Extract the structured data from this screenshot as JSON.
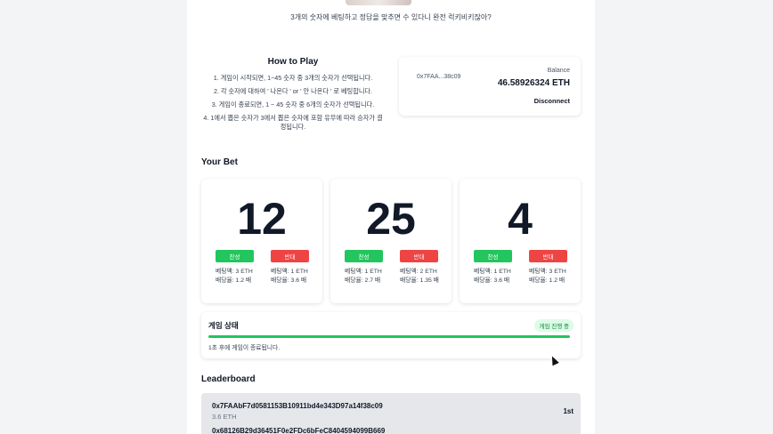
{
  "tagline": "3개의 숫자에 베팅하고 정답을 맞추면 수 있다니 완전 럭키비키잖아?",
  "how_to_play": {
    "title": "How to Play",
    "steps": [
      "1. 게임이 시작되면, 1~45 숫자 중 3개의 숫자가 선택됩니다.",
      "2. 각 숫자에 대하여 ' 나온다 ' or ' 안 나온다 ' 로 베팅합니다.",
      "3. 게임이 종료되면, 1 ~ 45 숫자 중 6개의 숫자가 선택됩니다.",
      "4. 1에서 뽑은 숫자가 3에서 뽑은 숫자에 포함 유무에 따라 승자가 결정됩니다."
    ]
  },
  "wallet": {
    "address": "0x7FAA...38c09",
    "balance_label": "Balance",
    "balance": "46.58926324 ETH",
    "disconnect_label": "Disconnect"
  },
  "your_bet_title": "Your Bet",
  "bets": [
    {
      "number": "12",
      "yes_label": "찬성",
      "no_label": "반대",
      "yes_amount": "베팅액: 3 ETH",
      "yes_odds": "배당율: 1.2 배",
      "no_amount": "베팅액: 1 ETH",
      "no_odds": "배당율: 3.6 배"
    },
    {
      "number": "25",
      "yes_label": "찬성",
      "no_label": "반대",
      "yes_amount": "베팅액: 1 ETH",
      "yes_odds": "배당율: 2.7 배",
      "no_amount": "베팅액: 2 ETH",
      "no_odds": "배당율: 1.35 배"
    },
    {
      "number": "4",
      "yes_label": "찬성",
      "no_label": "반대",
      "yes_amount": "베팅액: 1 ETH",
      "yes_odds": "배당율: 3.6 배",
      "no_amount": "베팅액: 3 ETH",
      "no_odds": "배당율: 1.2 배"
    }
  ],
  "game_status": {
    "title": "게임 상태",
    "badge": "게임 진행 중",
    "progress": 1.0,
    "note": "1초 후에 게임이 종료됩니다."
  },
  "leaderboard": {
    "title": "Leaderboard",
    "entries": [
      {
        "address": "0x7FAAbF7d0581153B10911bd4e343D97a14f38c09",
        "amount": "3.6 ETH",
        "rank": "1st"
      },
      {
        "address": "0x68126B29d36451F0e2FDc6bFeC8404594099B669"
      }
    ]
  },
  "colors": {
    "yes": "#22c55e",
    "no": "#ef4444",
    "progress": "#22c55e"
  }
}
